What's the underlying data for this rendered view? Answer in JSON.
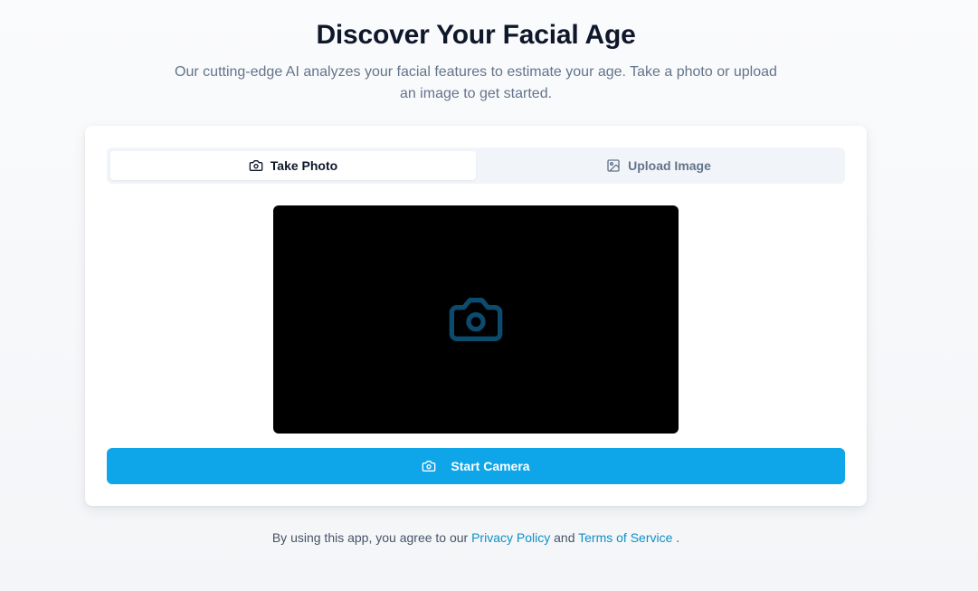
{
  "header": {
    "title": "Discover Your Facial Age",
    "subtitle": "Our cutting-edge AI analyzes your facial features to estimate your age. Take a photo or upload an image to get started."
  },
  "tabs": [
    {
      "label": "Take Photo",
      "icon": "camera-icon",
      "active": true
    },
    {
      "label": "Upload Image",
      "icon": "image-icon",
      "active": false
    }
  ],
  "camera": {
    "placeholder_icon": "camera-icon",
    "start_button_label": "Start Camera"
  },
  "footer": {
    "prefix": "By using this app, you agree to our ",
    "privacy_link": "Privacy Policy",
    "and": " and ",
    "terms_link": "Terms of Service",
    "suffix": " ."
  },
  "colors": {
    "accent": "#0ea5e9",
    "camera_placeholder_icon": "#0c4a6e",
    "link": "#0e90c8",
    "title": "#0f172a",
    "muted_text": "#64748b"
  }
}
